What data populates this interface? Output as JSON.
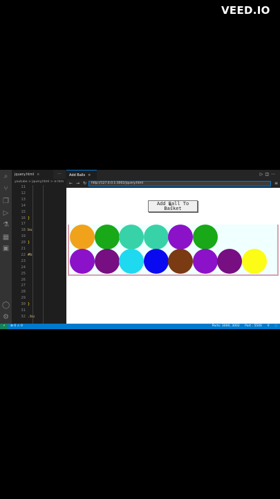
{
  "watermark": "VEED.IO",
  "editor": {
    "tab": "jquery.html",
    "tab_close": "×",
    "more": "···",
    "breadcrumb": "youtube > jquery.html > ⊘ htm",
    "line_numbers": [
      "11",
      "12",
      "13",
      "14",
      "15",
      "16",
      "17",
      "18",
      "19",
      "20",
      "21",
      "22",
      "23",
      "24",
      "25",
      "26",
      "27",
      "28",
      "29",
      "30",
      "31",
      "32"
    ],
    "code_lines": [
      {
        "line": 16,
        "text": "}",
        "color": "#ffd700"
      },
      {
        "line": 18,
        "text": "bu",
        "color": "#d7ba7d"
      },
      {
        "line": 20,
        "text": "}",
        "color": "#ffd700"
      },
      {
        "line": 22,
        "text": "#b",
        "color": "#d7ba7d"
      },
      {
        "line": 30,
        "text": "}",
        "color": "#ffd700"
      },
      {
        "line": 32,
        "text": ".bu",
        "color": "#d7ba7d"
      }
    ]
  },
  "preview": {
    "tab": "Add Balls",
    "tab_close": "×",
    "url": "http://127.0.0.1:3002/jquery.html",
    "add_button_label": "Add Ball To Basket",
    "balls_row1": [
      "#f0a21a",
      "#18a818",
      "#38d2a8",
      "#38d2a8",
      "#8b12c8",
      "#18a818"
    ],
    "balls_row2": [
      "#8b12c8",
      "#770e82",
      "#1ed9f0",
      "#0a0af0",
      "#7a3a12",
      "#8b12c8",
      "#770e82",
      "#fcfc16"
    ]
  },
  "statusbar": {
    "remote": "⚡",
    "problems": "⊗ 0 ⚠ 0",
    "ports": "Ports: 3000, 3002",
    "port_indicator": "Port : 5500",
    "bell": "🔔"
  },
  "colors": {
    "activity_bar": "#333333",
    "editor_bg": "#1e1e1e",
    "statusbar": "#007acc",
    "basket_bg": "#f0ffff",
    "basket_border": "#d8a0b0"
  }
}
